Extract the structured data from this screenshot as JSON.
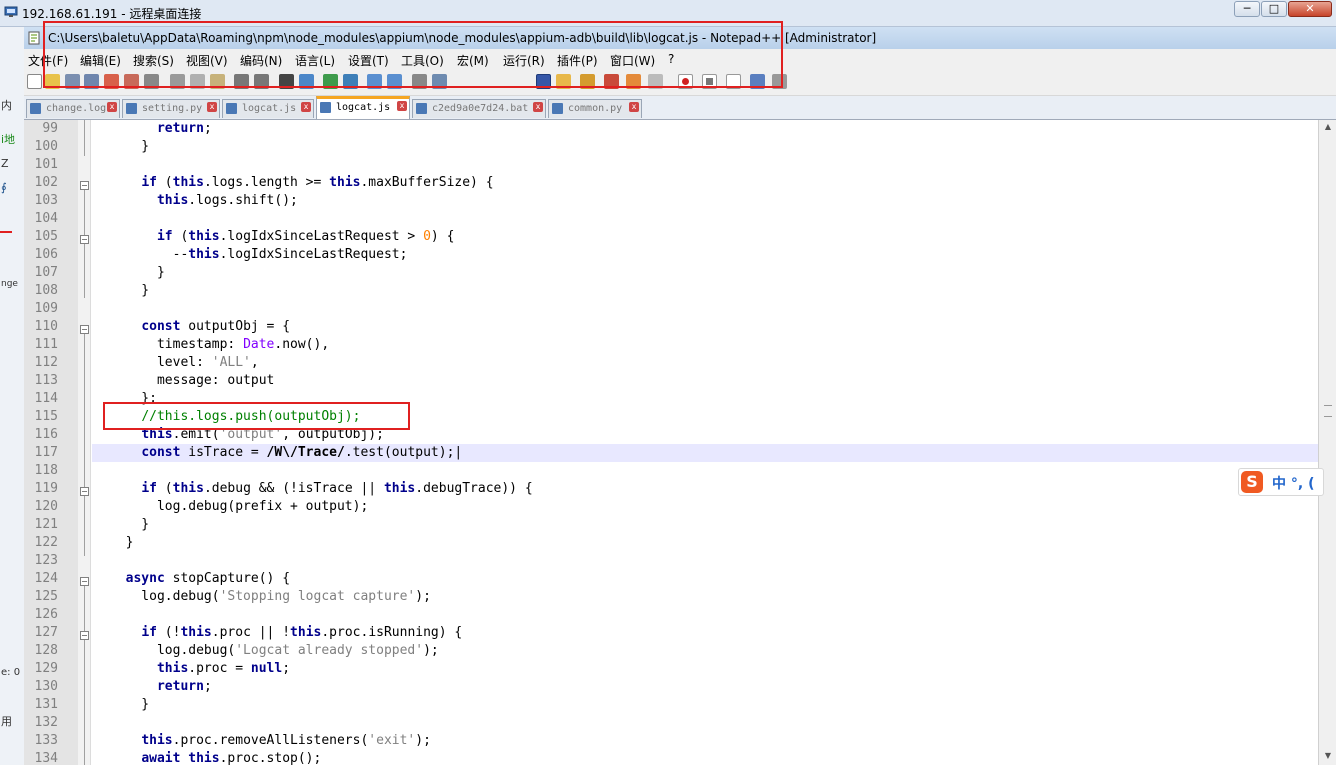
{
  "rdp": {
    "title": "192.168.61.191 - 远程桌面连接",
    "minimize": "─",
    "maximize": "□",
    "close": "✕"
  },
  "left_strip": [
    "内",
    "i地",
    "Z",
    "∮",
    "nge",
    "e: 0",
    "用"
  ],
  "npp": {
    "title": "C:\\Users\\baletu\\AppData\\Roaming\\npm\\node_modules\\appium\\node_modules\\appium-adb\\build\\lib\\logcat.js - Notepad++ [Administrator]",
    "menu": [
      "文件(F)",
      "编辑(E)",
      "搜索(S)",
      "视图(V)",
      "编码(N)",
      "语言(L)",
      "设置(T)",
      "工具(O)",
      "宏(M)",
      "运行(R)",
      "插件(P)",
      "窗口(W)",
      "?"
    ],
    "tabs": [
      {
        "name": "change.log",
        "active": false
      },
      {
        "name": "setting.py",
        "active": false
      },
      {
        "name": "logcat.js",
        "active": false
      },
      {
        "name": "logcat.js",
        "active": true
      },
      {
        "name": "c2ed9a0e7d24.bat",
        "active": false
      },
      {
        "name": "common.py",
        "active": false
      }
    ],
    "tab_close": "x"
  },
  "editor": {
    "line_numbers": [
      "99",
      "100",
      "101",
      "102",
      "103",
      "104",
      "105",
      "106",
      "107",
      "108",
      "109",
      "110",
      "111",
      "112",
      "113",
      "114",
      "115",
      "116",
      "117",
      "118",
      "119",
      "120",
      "121",
      "122",
      "123",
      "124",
      "125",
      "126",
      "127",
      "128",
      "129",
      "130",
      "131",
      "132",
      "133",
      "134"
    ],
    "current_line": "117"
  },
  "ime": {
    "logo": "S",
    "text": "中 °, ("
  },
  "colors": {
    "annotation": "#e02020",
    "keyword": "#00008b",
    "comment": "#008000",
    "string": "#808080",
    "active_tab_accent": "#f5a623"
  }
}
